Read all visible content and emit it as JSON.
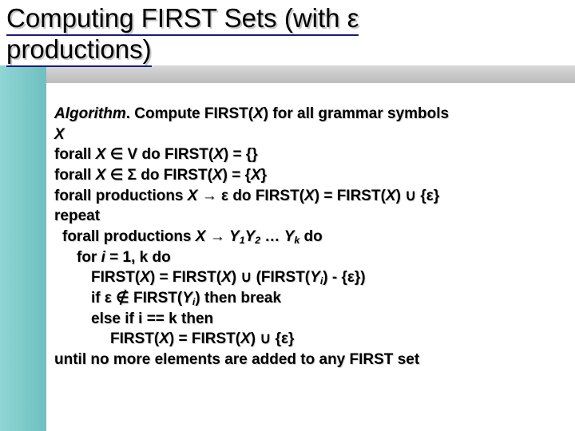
{
  "title": {
    "l1a": "Computing FIRST Sets (with ",
    "l1eps": "ε",
    "l2": "productions)"
  },
  "algo": {
    "l1a": "Algorithm",
    "l1b": ". Compute FIRST(",
    "l1x": "X",
    "l1c": ") for all grammar symbols",
    "l2": "X",
    "l3a": "forall ",
    "l3x": "X",
    "l3b": " ∈ V do FIRST(",
    "l3x2": "X",
    "l3c": ") = {}",
    "l4a": "forall ",
    "l4x": "X",
    "l4b": " ∈ Σ do FIRST(",
    "l4x2": "X",
    "l4c": ") = {",
    "l4x3": "X",
    "l4d": "}",
    "l5a": "forall productions ",
    "l5x": "X",
    "l5b": " → ε do  FIRST(",
    "l5x2": "X",
    "l5c": ") = FIRST(",
    "l5x3": "X",
    "l5d": ") ∪ {ε}",
    "l6": "repeat",
    "l7a": "forall productions ",
    "l7x": "X",
    "l7b": " → ",
    "l7y1": "Y",
    "l7s1": "1",
    "l7y2": "Y",
    "l7s2": "2",
    "l7c": " … ",
    "l7yk": "Y",
    "l7sk": "k",
    "l7d": "  do",
    "l8a": "for ",
    "l8i": "i",
    "l8b": "  = 1, k do",
    "l9a": "FIRST(",
    "l9x": "X",
    "l9b": ") = FIRST(",
    "l9x2": "X",
    "l9c": ") ∪ (FIRST(",
    "l9y": "Y",
    "l9si": "i",
    "l9d": ") - {ε})",
    "l10a": "if ε ∉ FIRST(",
    "l10y": "Y",
    "l10si": "i",
    "l10b": ") then break",
    "l11": "else if i == k then",
    "l12a": "FIRST(",
    "l12x": "X",
    "l12b": ") = FIRST(",
    "l12x2": "X",
    "l12c": ") ∪ {ε}",
    "l13": "until no more elements are added to any FIRST set"
  }
}
